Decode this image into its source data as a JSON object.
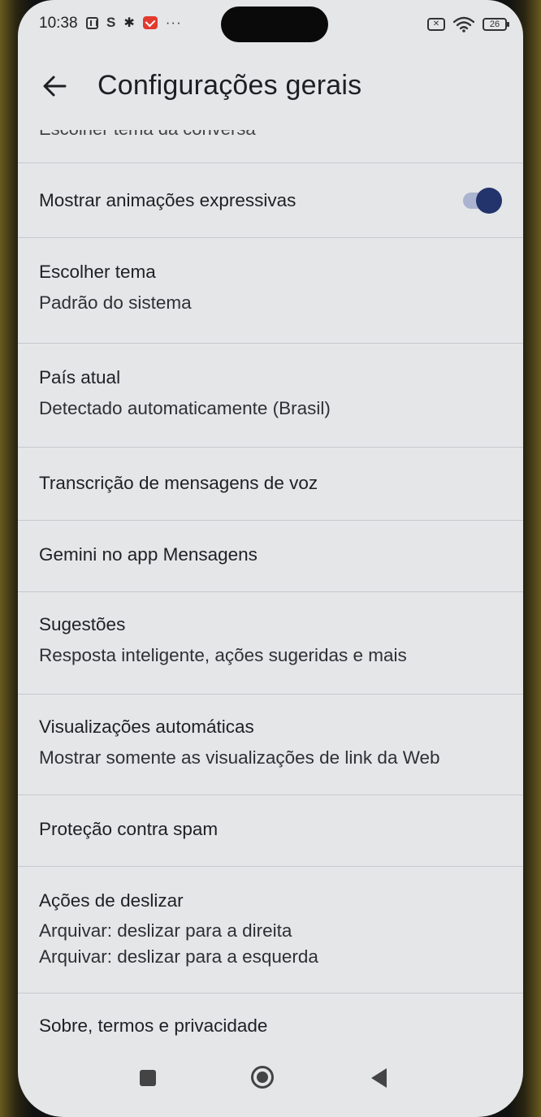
{
  "status_bar": {
    "time": "10:38",
    "battery_level": "26",
    "more_indicator": "···"
  },
  "header": {
    "title": "Configurações gerais"
  },
  "list": {
    "cut_item": "Escolher tema da conversa",
    "items": [
      {
        "title": "Mostrar animações expressivas",
        "toggle_on": true
      },
      {
        "title": "Escolher tema",
        "subtitle": "Padrão do sistema"
      },
      {
        "title": "País atual",
        "subtitle": "Detectado automaticamente (Brasil)"
      },
      {
        "title": "Transcrição de mensagens de voz"
      },
      {
        "title": "Gemini no app Mensagens"
      },
      {
        "title": "Sugestões",
        "subtitle": "Resposta inteligente, ações sugeridas e mais"
      },
      {
        "title": "Visualizações automáticas",
        "subtitle": "Mostrar somente as visualizações de link da Web"
      },
      {
        "title": "Proteção contra spam"
      },
      {
        "title": "Ações de deslizar",
        "subtitle": "Arquivar: deslizar para a direita",
        "subtitle2": "Arquivar: deslizar para a esquerda"
      },
      {
        "title": "Sobre, termos e privacidade"
      }
    ]
  },
  "colors": {
    "background": "#e4e6e8",
    "toggle_thumb": "#23336b",
    "toggle_track": "#aab3cf",
    "divider": "#c7c9cc"
  }
}
